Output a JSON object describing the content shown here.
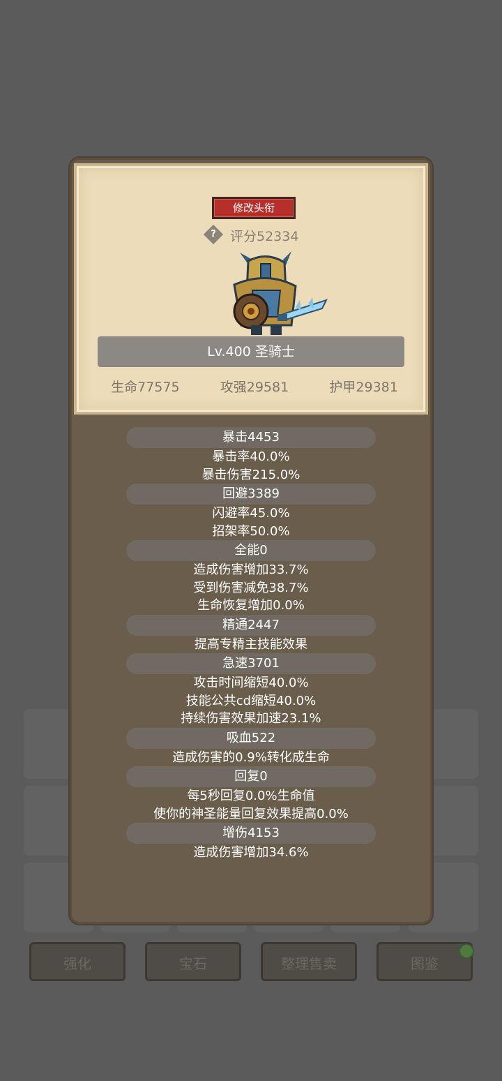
{
  "rename_button": "修改头衔",
  "help_icon_glyph": "?",
  "score": "评分52334",
  "hero_name": "Lv.400 圣骑士",
  "base_stats": [
    "生命77575",
    "攻强29581",
    "护甲29381"
  ],
  "attributes": [
    {
      "header": "暴击4453",
      "details": [
        "暴击率40.0%",
        "暴击伤害215.0%"
      ]
    },
    {
      "header": "回避3389",
      "details": [
        "闪避率45.0%",
        "招架率50.0%"
      ]
    },
    {
      "header": "全能0",
      "details": [
        "造成伤害增加33.7%",
        "受到伤害减免38.7%",
        "生命恢复增加0.0%"
      ]
    },
    {
      "header": "精通2447",
      "details": [
        "提高专精主技能效果"
      ]
    },
    {
      "header": "急速3701",
      "details": [
        "攻击时间缩短40.0%",
        "技能公共cd缩短40.0%",
        "持续伤害效果加速23.1%"
      ]
    },
    {
      "header": "吸血522",
      "details": [
        "造成伤害的0.9%转化成生命"
      ]
    },
    {
      "header": "回复0",
      "details": [
        "每5秒回复0.0%生命值",
        "使你的神圣能量回复效果提高0.0%"
      ]
    },
    {
      "header": "增伤4153",
      "details": [
        "造成伤害增加34.6%"
      ]
    }
  ],
  "bottom_buttons": [
    "强化",
    "宝石",
    "整理售卖",
    "图鉴"
  ],
  "icons": {
    "help": "question-diamond-icon",
    "badge": "notification-dot-icon"
  },
  "colors": {
    "rename_red": "#b72f2a",
    "parchment": "#ecdcb9",
    "panel_brown": "#6b5d4b"
  }
}
